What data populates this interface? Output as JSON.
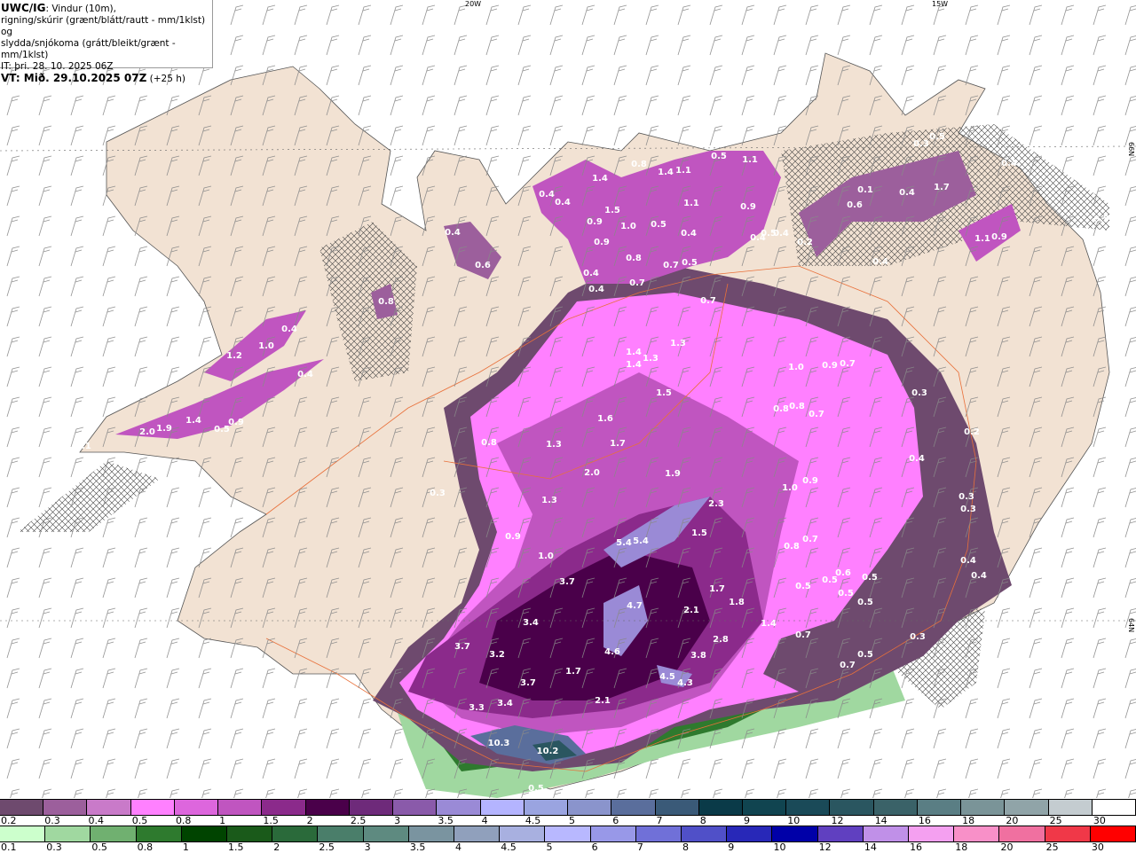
{
  "header": {
    "model": "UWC/IG",
    "line1": ": Vindur (10m),",
    "line2": "rigning/skúrir (grænt/blátt/rautt - mm/1klst) og",
    "line3": "slydda/snjókoma (grátt/bleikt/grænt - mm/1klst)",
    "init_time": "IT: þri. 28. 10. 2025 06Z",
    "valid_time_bold": "VT: Mið. 29.10.2025 07Z",
    "valid_offset": " (+25 h)"
  },
  "grid_labels": {
    "lon_20w": "20W",
    "lon_15w": "15W",
    "lat_66n": "66N",
    "lat_64n": "64N"
  },
  "colors": {
    "land": "#f2e2d3",
    "sea": "#ffffff",
    "roads": "#e8703a",
    "barbs": "#888888"
  },
  "legend_snow": {
    "labels": [
      "0.2",
      "0.3",
      "0.4",
      "0.5",
      "0.8",
      "1",
      "1.5",
      "2",
      "2.5",
      "3",
      "3.5",
      "4",
      "4.5",
      "5",
      "6",
      "7",
      "8",
      "9",
      "10",
      "12",
      "14",
      "16",
      "18",
      "20",
      "25",
      "30"
    ],
    "colors": [
      "#6e4a6e",
      "#9c5f9c",
      "#c97ac9",
      "#ff80ff",
      "#dd66dd",
      "#c055c0",
      "#8b2a8b",
      "#4a004a",
      "#6e2a7a",
      "#8a5aaa",
      "#9a8ad6",
      "#b4b4ff",
      "#9aa4e0",
      "#8a94cc",
      "#5a6e9c",
      "#3a5a78",
      "#0a3a48",
      "#104450",
      "#1a4a58",
      "#2a5660",
      "#3a6268",
      "#5a7e84",
      "#7a9498",
      "#90a4a8",
      "#c4ccd0",
      "#ffffff"
    ]
  },
  "legend_rain": {
    "labels": [
      "0.1",
      "0.3",
      "0.5",
      "0.8",
      "1",
      "1.5",
      "2",
      "2.5",
      "3",
      "3.5",
      "4",
      "4.5",
      "5",
      "6",
      "7",
      "8",
      "9",
      "10",
      "12",
      "14",
      "16",
      "18",
      "20",
      "25",
      "30"
    ],
    "colors": [
      "#ccffcc",
      "#a0d8a0",
      "#70b070",
      "#2e7a2e",
      "#004400",
      "#1a5a1a",
      "#2a6a3a",
      "#4a7e6a",
      "#5e8a80",
      "#7a94a0",
      "#90a0bc",
      "#a8b0e0",
      "#b8b8ff",
      "#9898e8",
      "#7070d8",
      "#5050c8",
      "#2828b8",
      "#0000a8",
      "#6040c0",
      "#c090e8",
      "#f4a0f0",
      "#f890c8",
      "#f070a0",
      "#f03848",
      "#ff0000"
    ]
  },
  "value_labels": [
    "0.4",
    "0.6",
    "0.4",
    "0.4",
    "1.4",
    "1.5",
    "0.9",
    "0.9",
    "1.0",
    "0.5",
    "0.4",
    "0.8",
    "1.4",
    "1.1",
    "1.1",
    "0.8",
    "0.7",
    "0.5",
    "0.7",
    "0.4",
    "0.4",
    "0.5",
    "1.1",
    "0.9",
    "0.4",
    "0.5",
    "0.4",
    "0.2",
    "0.1",
    "0.6",
    "0.4",
    "1.7",
    "0.3",
    "0.5",
    "0.4",
    "0.4",
    "1.1",
    "0.9",
    "0.5",
    "0.8",
    "0.4",
    "1.2",
    "1.0",
    "0.4",
    "1.4",
    "1.9",
    "2.0",
    "0.9",
    "0.5",
    "0.1",
    "0.7",
    "1.4",
    "1.4",
    "1.3",
    "1.3",
    "1.5",
    "1.0",
    "0.9",
    "0.7",
    "0.3",
    "0.8",
    "0.8",
    "0.7",
    "1.6",
    "1.7",
    "0.8",
    "1.3",
    "2.0",
    "1.9",
    "0.3",
    "1.3",
    "2.3",
    "1.5",
    "0.9",
    "1.0",
    "5.4",
    "5.4",
    "0.2",
    "0.4",
    "1.0",
    "0.9",
    "0.3",
    "0.3",
    "0.7",
    "0.8",
    "0.4",
    "0.4",
    "0.6",
    "0.5",
    "0.5",
    "0.5",
    "0.5",
    "0.5",
    "0.3",
    "0.7",
    "0.7",
    "0.5",
    "1.4",
    "3.7",
    "4.7",
    "1.7",
    "1.8",
    "2.1",
    "3.4",
    "2.8",
    "3.7",
    "3.2",
    "4.6",
    "3.8",
    "1.7",
    "3.7",
    "4.5",
    "4.3",
    "3.3",
    "3.4",
    "2.1",
    "10.3",
    "10.2",
    "0.5"
  ]
}
